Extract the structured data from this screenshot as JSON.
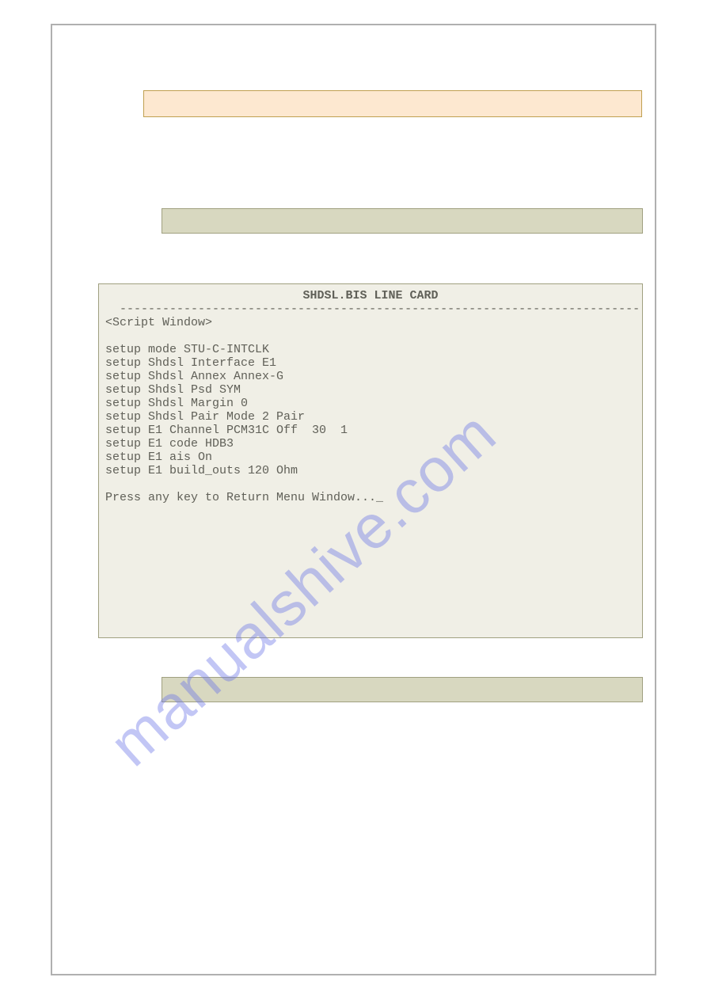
{
  "watermark": "manualshive.com",
  "terminal": {
    "title": "SHDSL.BIS LINE CARD",
    "rule": "-------------------------------------------------------------------------",
    "section": "<Script Window>",
    "lines": [
      "setup mode STU-C-INTCLK",
      "setup Shdsl Interface E1",
      "setup Shdsl Annex Annex-G",
      "setup Shdsl Psd SYM",
      "setup Shdsl Margin 0",
      "setup Shdsl Pair Mode 2 Pair",
      "setup E1 Channel PCM31C Off  30  1",
      "setup E1 code HDB3",
      "setup E1 ais On",
      "setup E1 build_outs 120 Ohm"
    ],
    "prompt": "Press any key to Return Menu Window..._"
  }
}
